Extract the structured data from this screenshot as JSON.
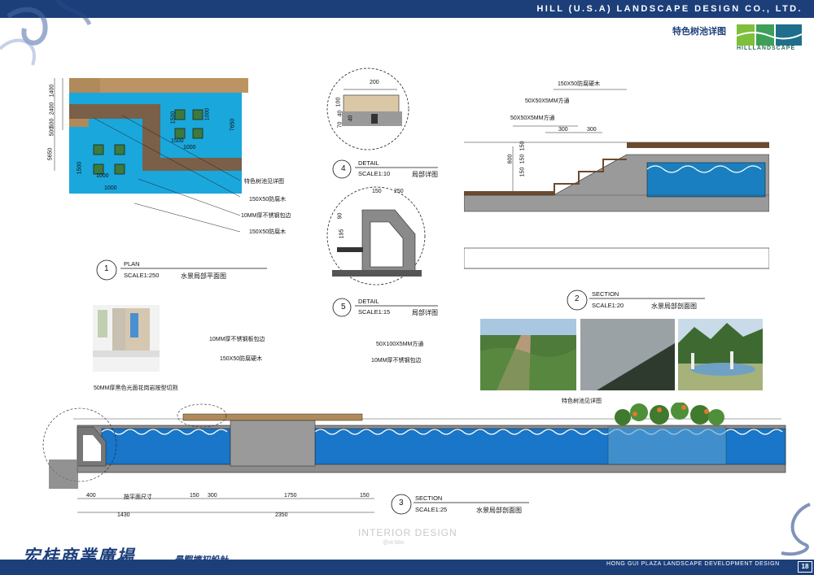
{
  "header": {
    "company": "HILL (U.S.A) LANDSCAPE  DESIGN CO., LTD.",
    "sheet_title": "特色树池详图",
    "logo_text": "HILLLANDSCAPE"
  },
  "footer": {
    "project_cn": "宏桂商業廣場",
    "project_sub": "景觀擴初設計",
    "project_en": "HONG  GUI  PLAZA  LANDSCAPE DEVELOPMENT DESIGN",
    "page": "18"
  },
  "watermark": {
    "main": "INTERIOR DESIGN",
    "sub": "@ot-bbs"
  },
  "drawings": {
    "plan": {
      "num": "1",
      "type": "PLAN",
      "scale": "SCALE1:250",
      "cn": "水景局部平面图"
    },
    "section2": {
      "num": "2",
      "type": "SECTION",
      "scale": "SCALE1:20",
      "cn": "水景局部剖面图"
    },
    "section3": {
      "num": "3",
      "type": "SECTION",
      "scale": "SCALE1:25",
      "cn": "水景局部剖面图"
    },
    "detail4": {
      "num": "4",
      "type": "DETAIL",
      "scale": "SCALE1:10",
      "cn": "局部详图"
    },
    "detail5": {
      "num": "5",
      "type": "DETAIL",
      "scale": "SCALE1:15",
      "cn": "局部详图"
    }
  },
  "plan_labels": {
    "tree_pit": "特色树池见详图",
    "timber1": "150X50防腐木",
    "steel_edge": "10MM厚不锈钢包边",
    "timber2": "150X50防腐木",
    "dims_left": [
      "1400",
      "2400",
      "500",
      "500",
      "5650"
    ],
    "dims_inner": [
      "1500",
      "1000",
      "1000",
      "1500",
      "1000",
      "1000",
      "1500",
      "7650"
    ]
  },
  "detail4_dims": [
    "200",
    "100",
    "40",
    "70",
    "40"
  ],
  "detail5_dims": [
    "150",
    "250",
    "90",
    "195"
  ],
  "section2_labels": {
    "timber": "150X50防腐硬木",
    "tube1": "50X50X5MM方通",
    "tube2": "50X50X5MM方通",
    "d1": "300",
    "d2": "300",
    "v1": "150",
    "v2": "150",
    "v3": "150",
    "v4": "600"
  },
  "section3_labels": {
    "steel_plate": "10MM厚不锈钢板包边",
    "hardwood": "150X50防腐硬木",
    "tube": "50X100X5MM方通",
    "steel_edge": "10MM厚不锈钢包边",
    "granite": "50MM厚黑色光面花岗岩按型切割",
    "tree_pit": "特色树池见详图",
    "dims_top": [
      "400",
      "按平面尺寸",
      "150",
      "300",
      "1750",
      "150"
    ],
    "dims_bottom": [
      "1430",
      "2350"
    ]
  },
  "colors": {
    "brand_blue": "#1c3f7a",
    "water": "#1aa7dc",
    "wood": "#8b6a45",
    "paving": "#b08a5a"
  }
}
